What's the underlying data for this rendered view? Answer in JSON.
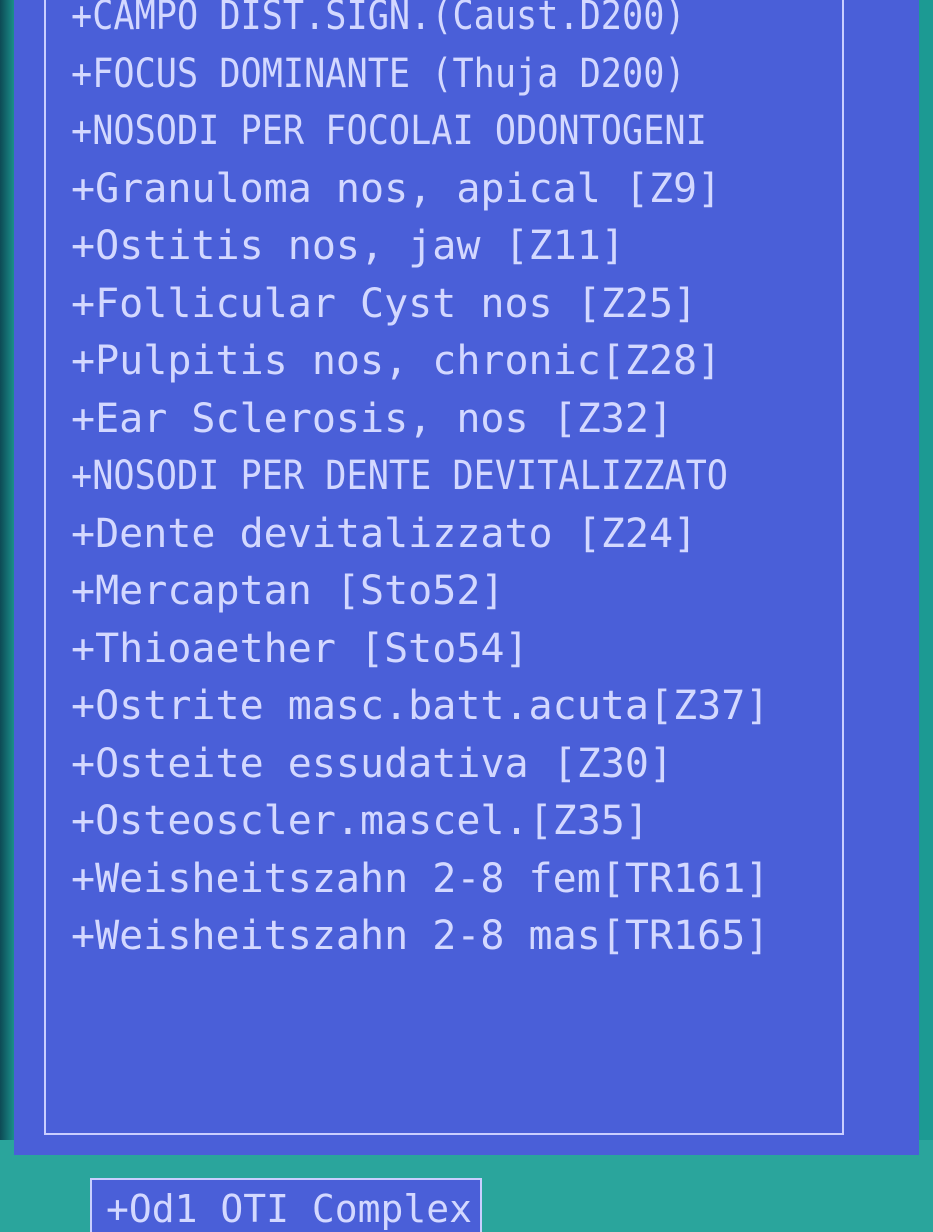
{
  "colors": {
    "background": "#1a8f8a",
    "panel": "#4a5fd8",
    "text": "#d3d8ff",
    "border": "#c9ceff"
  },
  "list": {
    "items": [
      "+CAMPO DIST.SIGN.(Caust.D200)",
      "+FOCUS DOMINANTE (Thuja D200)",
      "+NOSODI PER FOCOLAI ODONTOGENI",
      "+Granuloma nos, apical [Z9]",
      "+Ostitis nos, jaw [Z11]",
      "+Follicular Cyst nos [Z25]",
      "+Pulpitis nos, chronic[Z28]",
      "+Ear Sclerosis, nos [Z32]",
      "+NOSODI PER DENTE DEVITALIZZATO",
      "+Dente devitalizzato [Z24]",
      "+Mercaptan [Sto52]",
      "+Thioaether [Sto54]",
      "+Ostrite masc.batt.acuta[Z37]",
      "+Osteite essudativa [Z30]",
      "+Osteoscler.mascel.[Z35]",
      "+Weisheitszahn 2-8 fem[TR161]",
      "+Weisheitszahn 2-8 mas[TR165]"
    ]
  },
  "bottom_box": {
    "label": "+Od1 OTI Complex"
  }
}
